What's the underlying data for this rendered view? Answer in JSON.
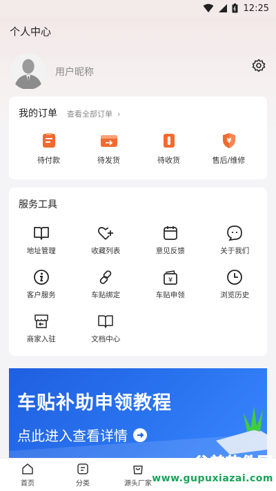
{
  "status_bar": {
    "time": "12:25"
  },
  "header": {
    "title": "个人中心"
  },
  "profile": {
    "nickname": "用户昵称"
  },
  "orders": {
    "title": "我的订单",
    "view_all": "查看全部订单",
    "items": [
      {
        "label": "待付款",
        "icon": "wallet-icon"
      },
      {
        "label": "待发货",
        "icon": "shipping-icon"
      },
      {
        "label": "待收货",
        "icon": "package-icon"
      },
      {
        "label": "售后/维修",
        "icon": "after-sales-icon"
      }
    ],
    "accent": "#f26a2e"
  },
  "tools": {
    "title": "服务工具",
    "items": [
      {
        "label": "地址管理",
        "icon": "book-icon"
      },
      {
        "label": "收藏列表",
        "icon": "heart-plus-icon"
      },
      {
        "label": "意见反馈",
        "icon": "calendar-icon"
      },
      {
        "label": "关于我们",
        "icon": "chat-bubble-icon"
      },
      {
        "label": "客户服务",
        "icon": "info-icon"
      },
      {
        "label": "车贴绑定",
        "icon": "link-icon"
      },
      {
        "label": "车贴申领",
        "icon": "money-icon"
      },
      {
        "label": "浏览历史",
        "icon": "clock-icon"
      },
      {
        "label": "商家入驻",
        "icon": "store-icon"
      },
      {
        "label": "文档中心",
        "icon": "document-icon"
      }
    ]
  },
  "banner": {
    "title": "车贴补助申领教程",
    "subtitle": "点此进入查看详情"
  },
  "tabbar": {
    "items": [
      {
        "label": "首页",
        "icon": "home-icon"
      },
      {
        "label": "分类",
        "icon": "category-icon"
      },
      {
        "label": "源头厂家",
        "icon": "factory-icon"
      }
    ]
  },
  "watermark": {
    "line1": "谷普软件园",
    "line2": "www.gupuxiazai.com"
  }
}
